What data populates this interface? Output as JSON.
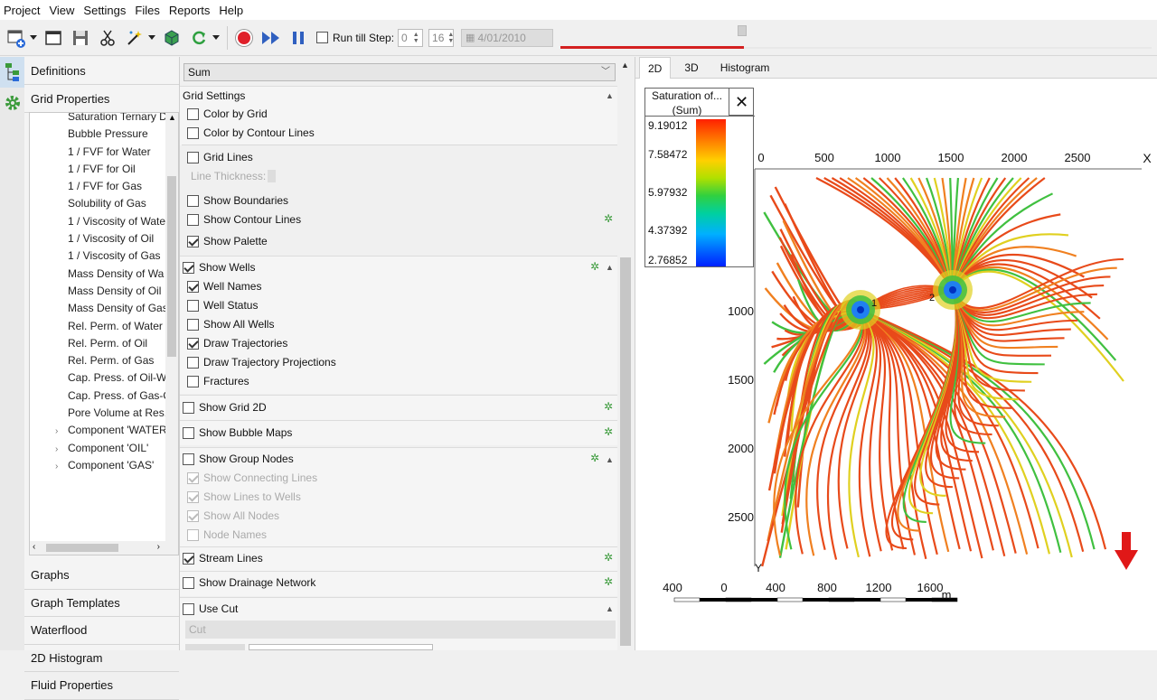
{
  "menu": [
    "Project",
    "View",
    "Settings",
    "Files",
    "Reports",
    "Help"
  ],
  "toolbar": {
    "run_till_step_label": "Run till Step:",
    "step_from": "0",
    "step_to": "16",
    "date": "4/01/2010",
    "timeline_progress": 0.3
  },
  "nav": {
    "definitions": "Definitions",
    "grid_properties": "Grid Properties",
    "tree_items": [
      "Saturation Ternary D",
      "Bubble Pressure",
      "1 / FVF for Water",
      "1 / FVF for Oil",
      "1 / FVF for Gas",
      "Solubility of Gas",
      "1 / Viscosity of Wate",
      "1 / Viscosity of Oil",
      "1 / Viscosity of Gas",
      "Mass Density of Wa",
      "Mass Density of Oil",
      "Mass Density of Gas",
      "Rel. Perm. of Water",
      "Rel. Perm. of Oil",
      "Rel. Perm. of Gas",
      "Cap. Press. of Oil-W",
      "Cap. Press. of Gas-O",
      "Pore Volume at Res."
    ],
    "tree_components": [
      "Component 'WATER",
      "Component 'OIL'",
      "Component 'GAS'"
    ],
    "bottom_items": [
      "Graphs",
      "Graph Templates",
      "Waterflood",
      "2D Histogram",
      "Fluid Properties"
    ]
  },
  "settings": {
    "combo_value": "Sum",
    "grid_settings_title": "Grid Settings",
    "color_by_grid": "Color by Grid",
    "color_by_contour": "Color by Contour Lines",
    "grid_lines": "Grid Lines",
    "line_thickness": "Line Thickness:",
    "show_boundaries": "Show Boundaries",
    "show_contour_lines": "Show Contour Lines",
    "show_palette": "Show Palette",
    "show_wells": "Show Wells",
    "well_names": "Well Names",
    "well_status": "Well Status",
    "show_all_wells": "Show All Wells",
    "draw_trajectories": "Draw Trajectories",
    "draw_trajectory_projections": "Draw Trajectory Projections",
    "fractures": "Fractures",
    "show_grid_2d": "Show Grid 2D",
    "show_bubble_maps": "Show Bubble Maps",
    "show_group_nodes": "Show Group Nodes",
    "show_connecting_lines": "Show Connecting Lines",
    "show_lines_to_wells": "Show Lines to Wells",
    "show_all_nodes": "Show All Nodes",
    "node_names": "Node Names",
    "stream_lines": "Stream Lines",
    "show_drainage_network": "Show Drainage Network",
    "use_cut": "Use Cut",
    "cut": "Cut"
  },
  "view": {
    "tabs": [
      "2D",
      "3D",
      "Histogram"
    ],
    "legend_title": "Saturation of...",
    "legend_subtitle": "(Sum)",
    "legend_values": [
      "9.19012",
      "7.58472",
      "5.97932",
      "4.37392",
      "2.76852"
    ],
    "x_ticks": [
      "0",
      "500",
      "1000",
      "1500",
      "2000",
      "2500"
    ],
    "x_axis": "X",
    "y_ticks": [
      "1000",
      "1500",
      "2000",
      "2500"
    ],
    "y_axis": "Y",
    "scale_ticks": [
      "400",
      "0",
      "400",
      "800",
      "1200",
      "1600"
    ],
    "scale_unit": "m",
    "well_label_1": "1",
    "well_label_2": "2"
  },
  "colors": {
    "record": "#e0202a",
    "play": "#3060c0",
    "stream_red": "#e84a1a",
    "stream_orange": "#f08020",
    "stream_yellow": "#e0d020",
    "stream_green": "#40c040",
    "stream_blue": "#2080f0",
    "arrow_red": "#e01818",
    "gear_green": "#3a9a3a"
  }
}
